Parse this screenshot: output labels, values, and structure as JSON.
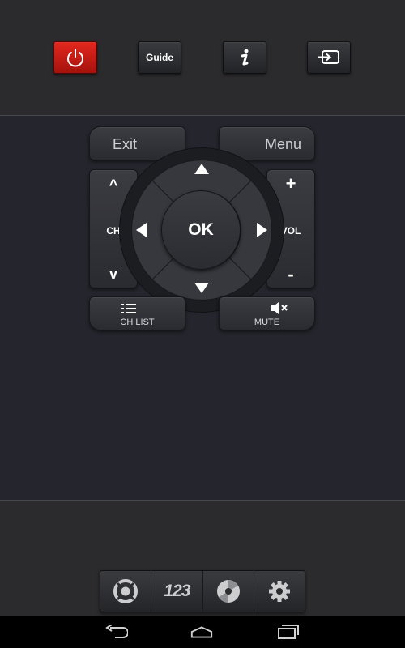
{
  "top_bar": {
    "guide_label": "Guide",
    "buttons": [
      "power-icon",
      "guide",
      "info-icon",
      "input-source-icon"
    ],
    "power_color": "#d71e16"
  },
  "remote": {
    "exit_label": "Exit",
    "menu_label": "Menu",
    "ok_label": "OK",
    "ch_label": "CH",
    "vol_label": "VOL",
    "ch_up": "^",
    "ch_down": "v",
    "vol_up": "+",
    "vol_down": "-",
    "ch_list_label": "CH LIST",
    "mute_label": "MUTE"
  },
  "bottom_tabs": {
    "numpad_label": "123",
    "tabs": [
      "remote-dpad-icon",
      "numpad",
      "media-disc-icon",
      "gear-icon"
    ]
  },
  "nav_bar": {
    "buttons": [
      "back-icon",
      "home-icon",
      "recents-icon"
    ]
  }
}
